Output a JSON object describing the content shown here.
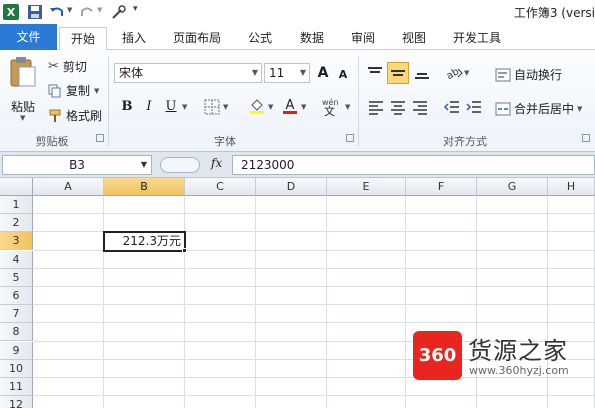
{
  "titlebar": {
    "title": "工作簿3 (versi"
  },
  "tabs": {
    "file": "文件",
    "home": "开始",
    "insert": "插入",
    "page_layout": "页面布局",
    "formulas": "公式",
    "data": "数据",
    "review": "审阅",
    "view": "视图",
    "developer": "开发工具"
  },
  "clipboard": {
    "paste": "粘贴",
    "cut": "剪切",
    "copy": "复制",
    "format_painter": "格式刷",
    "group_label": "剪贴板"
  },
  "font": {
    "name": "宋体",
    "size": "11",
    "bold": "B",
    "italic": "I",
    "underline": "U",
    "grow": "A",
    "shrink": "A",
    "group_label": "字体"
  },
  "alignment": {
    "wrap_text": "自动换行",
    "merge_center": "合并后居中",
    "group_label": "对齐方式"
  },
  "formula_bar": {
    "name_box": "B3",
    "fx": "fx",
    "value": "2123000"
  },
  "sheet": {
    "columns": [
      "A",
      "B",
      "C",
      "D",
      "E",
      "F",
      "G",
      "H"
    ],
    "selected_column": "B",
    "rows": [
      "1",
      "2",
      "3",
      "4",
      "5",
      "6",
      "7",
      "8",
      "9",
      "10",
      "11",
      "12"
    ],
    "selected_row": "3",
    "active_cell_display": "212.3万元"
  },
  "watermark": {
    "badge": "360",
    "name": "货源之家",
    "url": "www.360hyzj.com"
  },
  "colors": {
    "file_tab": "#2b7bd6",
    "selected_header": "#f2c25f",
    "watermark_badge": "#e8261f"
  }
}
